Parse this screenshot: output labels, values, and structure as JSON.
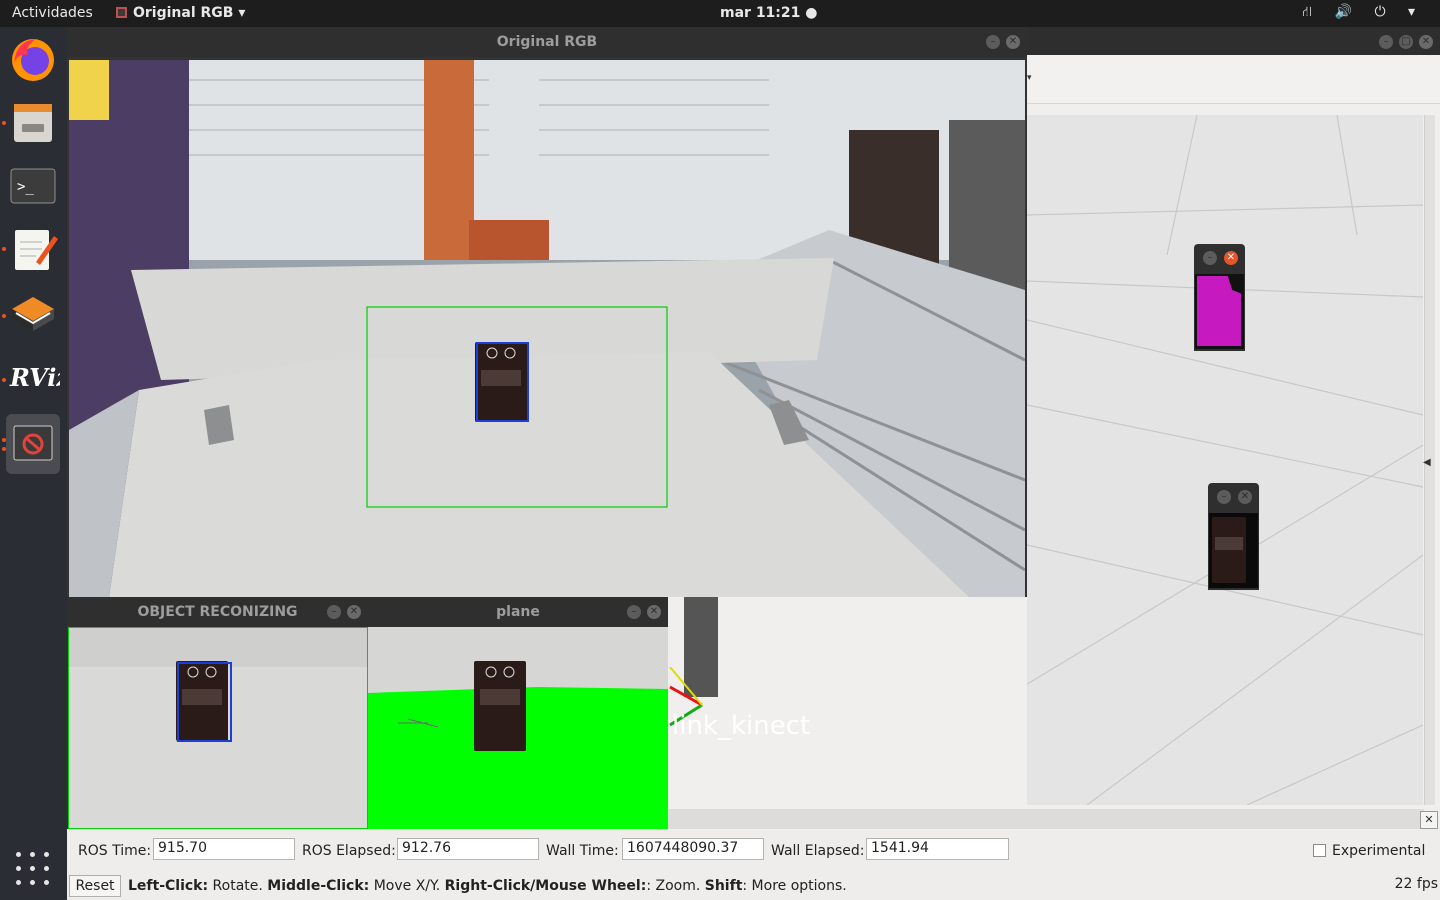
{
  "topbar": {
    "activities": "Actividades",
    "app_menu": "Original RGB",
    "clock": "mar 11:21 ●",
    "tray": "⛙ 🔊 ⏻ ▾"
  },
  "windows": {
    "original_rgb": {
      "title": "Original RGB"
    },
    "object_recognizing": {
      "title": "OBJECT RECONIZING"
    },
    "plane": {
      "title": "plane"
    }
  },
  "viewport": {
    "tf_label": "link_kinect"
  },
  "timebar": {
    "ros_time_label": "ROS Time:",
    "ros_time_value": "915.70",
    "ros_elapsed_label": "ROS Elapsed:",
    "ros_elapsed_value": "912.76",
    "wall_time_label": "Wall Time:",
    "wall_time_value": "1607448090.37",
    "wall_elapsed_label": "Wall Elapsed:",
    "wall_elapsed_value": "1541.94",
    "experimental_label": "Experimental"
  },
  "statusbar": {
    "reset_label": "Reset",
    "hint_left_click": "Left-Click:",
    "hint_rotate": " Rotate. ",
    "hint_middle_click": "Middle-Click:",
    "hint_move": " Move X/Y. ",
    "hint_right_click": "Right-Click/Mouse Wheel:",
    "hint_zoom": ": Zoom. ",
    "hint_shift": "Shift",
    "hint_more": ": More options.",
    "fps": "22 fps"
  },
  "dock": {
    "items": [
      "firefox-icon",
      "files-icon",
      "terminal-icon",
      "text-editor-icon",
      "software-icon",
      "rviz-icon",
      "opencv-window-icon"
    ]
  },
  "colors": {
    "ubuntu_orange": "#e95420",
    "bbox_green": "#00d000",
    "bbox_blue": "#1b3fd8",
    "mask_green": "#00ff00",
    "mask_magenta": "#c619c0"
  }
}
